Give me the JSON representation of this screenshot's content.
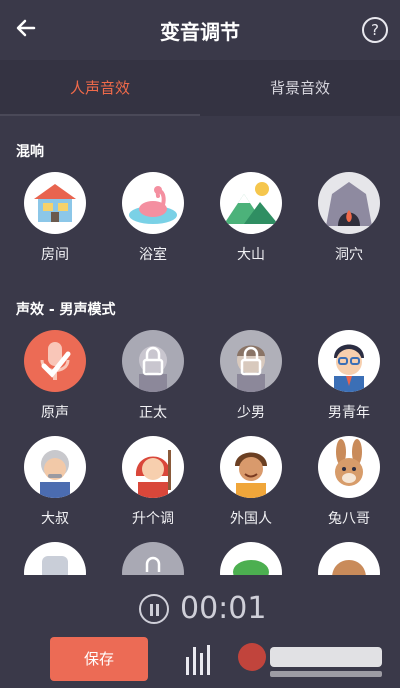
{
  "header": {
    "title": "变音调节",
    "help": "?"
  },
  "tabs": [
    {
      "label": "人声音效"
    },
    {
      "label": "背景音效"
    }
  ],
  "sections": {
    "reverb": {
      "title": "混响",
      "items": [
        {
          "label": "房间"
        },
        {
          "label": "浴室"
        },
        {
          "label": "大山"
        },
        {
          "label": "洞穴"
        }
      ]
    },
    "male": {
      "title": "声效 - 男声模式",
      "items": [
        {
          "label": "原声"
        },
        {
          "label": "正太"
        },
        {
          "label": "少男"
        },
        {
          "label": "男青年"
        },
        {
          "label": "大叔"
        },
        {
          "label": "升个调"
        },
        {
          "label": "外国人"
        },
        {
          "label": "兔八哥"
        }
      ]
    }
  },
  "player": {
    "timer": "00:01"
  },
  "footer": {
    "save": "保存"
  },
  "colors": {
    "accent": "#f06a4a",
    "background": "#3a3949",
    "save": "#ec6b55"
  }
}
